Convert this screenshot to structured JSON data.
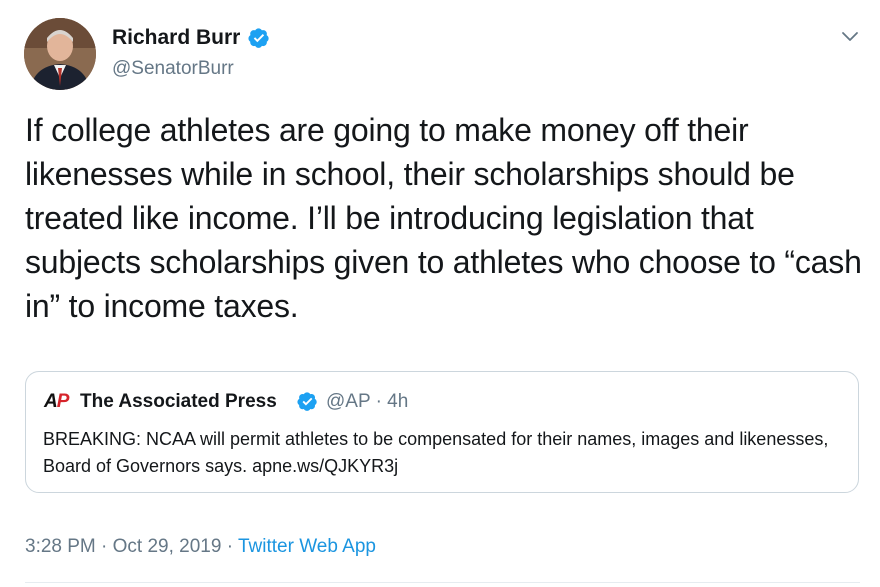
{
  "author": {
    "display_name": "Richard Burr",
    "handle": "@SenatorBurr",
    "verified": true
  },
  "tweet": {
    "text": "If college athletes are going to make money off their likenesses while in school, their scholarships should be treated like income. I’ll be introducing legislation that subjects scholarships given to athletes who choose to “cash in” to income taxes."
  },
  "quoted_tweet": {
    "logo_text_a": "A",
    "logo_text_p": "P",
    "display_name": "The Associated Press",
    "handle_time": "@AP · 4h",
    "verified": true,
    "text": "BREAKING: NCAA will permit athletes to be compensated for their names, images and likenesses, Board of Governors says. apne.ws/QJKYR3j"
  },
  "meta": {
    "timestamp": "3:28 PM · Oct 29, 2019 · ",
    "source": "Twitter Web App"
  },
  "icons": {
    "verified": "verified-badge-icon",
    "menu": "chevron-down-icon"
  },
  "colors": {
    "verified_blue": "#1da1f2",
    "link_blue": "#1b95e0",
    "secondary_text": "#657786",
    "border": "#ccd6dd"
  }
}
